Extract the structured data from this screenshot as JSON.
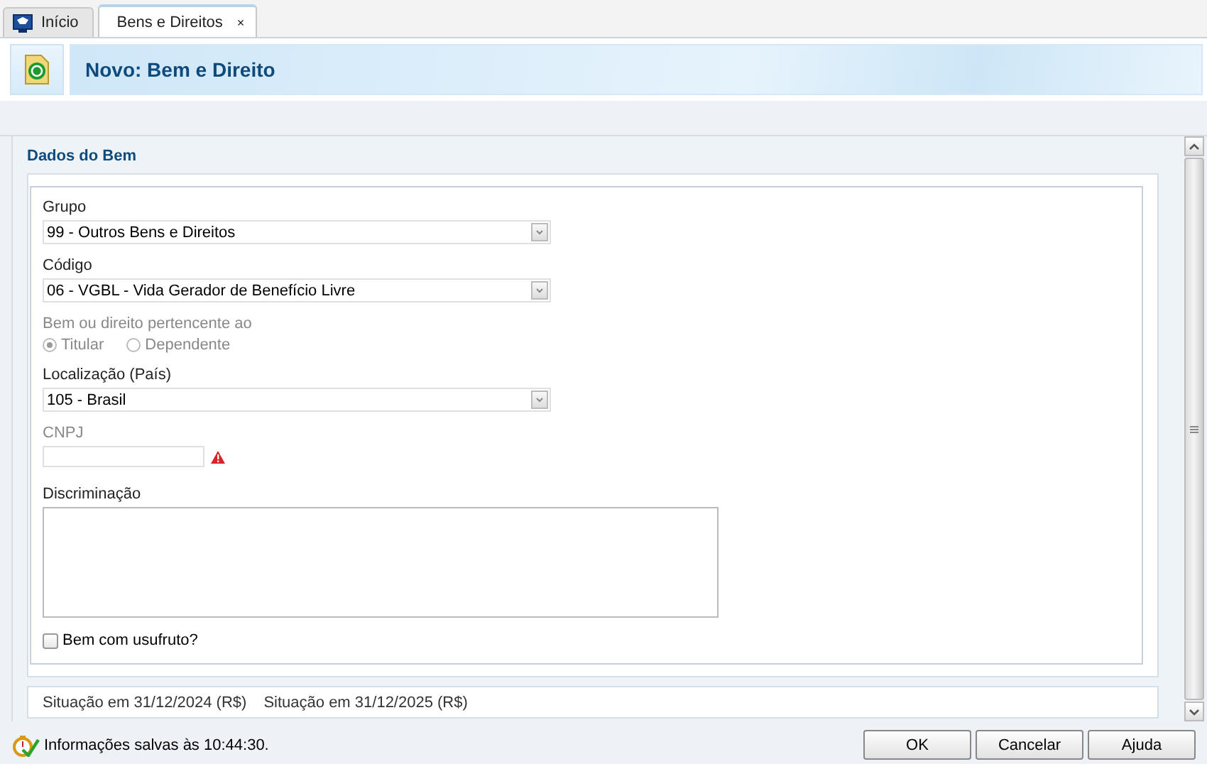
{
  "tabs": [
    {
      "kind": "home",
      "label": "Início",
      "selected": false
    },
    {
      "kind": "document",
      "label": "Bens e Direitos",
      "selected": true,
      "close": "×"
    }
  ],
  "header": {
    "title": "Novo: Bem e Direito"
  },
  "section": {
    "title": "Dados do Bem",
    "fields": [
      {
        "kind": "select",
        "label": "Grupo",
        "value": "99 - Outros Bens e Direitos"
      },
      {
        "kind": "select",
        "label": "Código",
        "value": "06 - VGBL - Vida Gerador de Benefício Livre"
      },
      {
        "kind": "radio",
        "label": "Bem ou direito pertencente ao",
        "disabled": true,
        "options": [
          {
            "label": "Titular",
            "selected": true
          },
          {
            "label": "Dependente",
            "selected": false
          }
        ]
      },
      {
        "kind": "select",
        "label": "Localização (País)",
        "value": "105 - Brasil"
      },
      {
        "kind": "text",
        "label": "CNPJ",
        "disabled": true,
        "warning": true
      },
      {
        "kind": "textarea",
        "label": "Discriminação"
      },
      {
        "kind": "checkbox",
        "label": "Bem com usufruto?",
        "checked": false
      }
    ]
  },
  "next_section": {
    "columns": [
      "Situação em 31/12/2024 (R$)",
      "Situação em 31/12/2025 (R$)"
    ]
  },
  "status_bar": {
    "message": "Informações salvas às 10:44:30."
  },
  "buttons": [
    {
      "label": "OK"
    },
    {
      "label": "Cancelar"
    },
    {
      "label": "Ajuda"
    }
  ]
}
